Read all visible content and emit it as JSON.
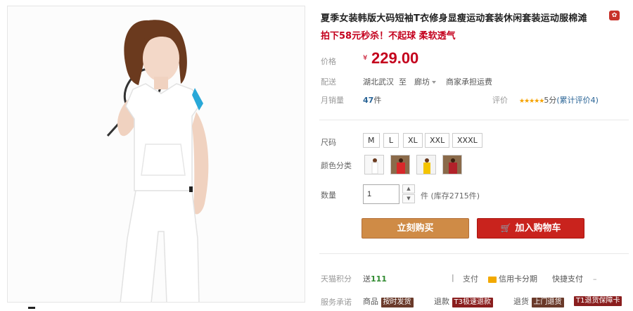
{
  "product": {
    "title": "夏季女装韩版大码短袖T衣修身显瘦运动套装休闲套装运动服棉滩",
    "subtitle": "拍下58元秒杀！不起球 柔软透气",
    "price_label": "价格",
    "currency": "¥",
    "price": "229.00",
    "shipping_label": "配送",
    "ship_from": "湖北武汉",
    "ship_to_word": "至",
    "ship_to": "廊坊",
    "ship_fee": "商家承担运费",
    "sold_label": "月销量",
    "sold_count": "47",
    "sold_unit": "件",
    "rating_label": "评价",
    "stars": "★★★★★",
    "rating_score": "5分",
    "review_link": "(累计评价4)"
  },
  "options": {
    "size_label": "尺码",
    "sizes": [
      "M",
      "L",
      "XL",
      "XXL",
      "XXXL"
    ],
    "color_label": "颜色分类",
    "quantity_label": "数量",
    "quantity": "1",
    "stock": "件 (库存2715件)"
  },
  "actions": {
    "buy_now": "立刻购买",
    "add_to_cart": "加入购物车"
  },
  "service": {
    "points_label": "天猫积分",
    "points_prefix": "送",
    "points_value": "111",
    "pay_label": "支付",
    "pay_credit": "信用卡分期",
    "pay_quick": "快捷支付",
    "promise_label": "服务承诺",
    "goods_label": "商品",
    "goods_tag": "按时发货",
    "refund_label": "退款",
    "refund_tag": "T3极速退款",
    "return_label": "退货",
    "return_tag": "上门退货",
    "return2_tag": "T1退货保障卡"
  },
  "colors": {
    "price_red": "#c4001d",
    "buy_orange": "#cf8b46",
    "cart_red": "#c9231d"
  }
}
